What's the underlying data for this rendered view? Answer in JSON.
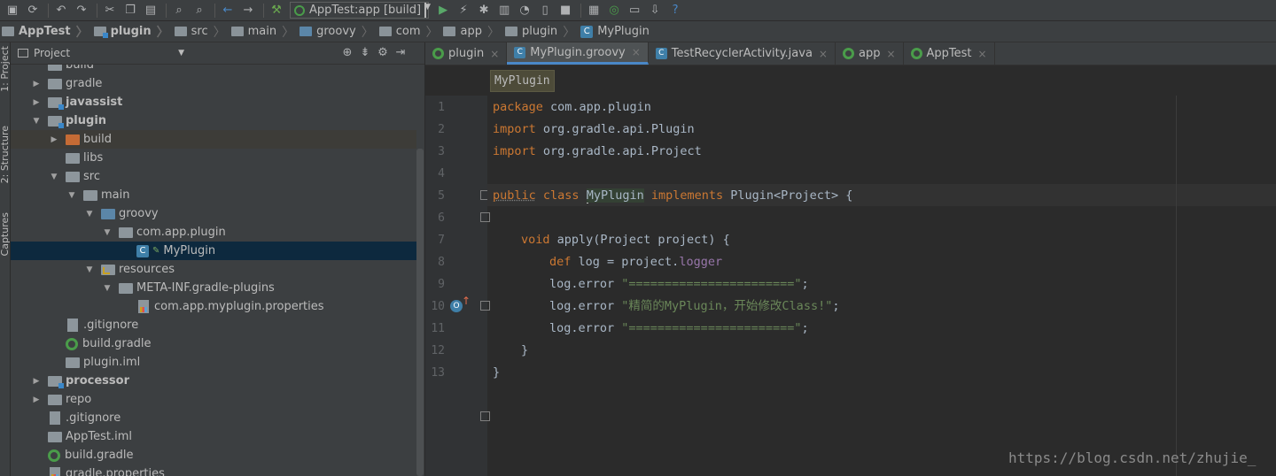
{
  "toolbar": {
    "icons": [
      "save-icon",
      "sync-icon",
      "undo-icon",
      "redo-icon",
      "cut-icon",
      "copy-icon",
      "paste-icon",
      "find-icon",
      "replace-icon",
      "back-icon",
      "forward-icon",
      "build-icon"
    ],
    "run_config": "AppTest:app [build]",
    "right_icons": [
      "run-icon",
      "debug-icon",
      "coverage-icon",
      "profile-icon",
      "attach-icon",
      "stop-icon",
      "sdk-icon",
      "avd-icon",
      "sync-gradle-icon",
      "structure-icon",
      "download-icon",
      "help-icon"
    ]
  },
  "breadcrumb": [
    "AppTest",
    "plugin",
    "src",
    "main",
    "groovy",
    "com",
    "app",
    "plugin",
    "MyPlugin"
  ],
  "side_tabs": {
    "project": "1: Project",
    "structure": "2: Structure",
    "captures": "Captures"
  },
  "project_panel": {
    "title": "Project",
    "tree": [
      {
        "label": "build",
        "level": 1,
        "arrow": "",
        "icon": "folder",
        "cut": true
      },
      {
        "label": "gradle",
        "level": 1,
        "arrow": "▶",
        "icon": "folder"
      },
      {
        "label": "javassist",
        "level": 1,
        "arrow": "▶",
        "icon": "module",
        "bold": true
      },
      {
        "label": "plugin",
        "level": 1,
        "arrow": "▼",
        "icon": "module",
        "bold": true
      },
      {
        "label": "build",
        "level": 2,
        "arrow": "▶",
        "icon": "orange"
      },
      {
        "label": "libs",
        "level": 2,
        "arrow": "",
        "icon": "folder"
      },
      {
        "label": "src",
        "level": 2,
        "arrow": "▼",
        "icon": "folder"
      },
      {
        "label": "main",
        "level": 3,
        "arrow": "▼",
        "icon": "folder"
      },
      {
        "label": "groovy",
        "level": 4,
        "arrow": "▼",
        "icon": "blue"
      },
      {
        "label": "com.app.plugin",
        "level": 5,
        "arrow": "▼",
        "icon": "package"
      },
      {
        "label": "MyPlugin",
        "level": 6,
        "arrow": "",
        "icon": "class"
      },
      {
        "label": "resources",
        "level": 4,
        "arrow": "▼",
        "icon": "res"
      },
      {
        "label": "META-INF.gradle-plugins",
        "level": 5,
        "arrow": "▼",
        "icon": "folder"
      },
      {
        "label": "com.app.myplugin.properties",
        "level": 6,
        "arrow": "",
        "icon": "properties"
      },
      {
        "label": ".gitignore",
        "level": 2,
        "arrow": "",
        "icon": "file"
      },
      {
        "label": "build.gradle",
        "level": 2,
        "arrow": "",
        "icon": "gradle"
      },
      {
        "label": "plugin.iml",
        "level": 2,
        "arrow": "",
        "icon": "iml"
      },
      {
        "label": "processor",
        "level": 1,
        "arrow": "▶",
        "icon": "module",
        "bold": true
      },
      {
        "label": "repo",
        "level": 1,
        "arrow": "▶",
        "icon": "folder"
      },
      {
        "label": ".gitignore",
        "level": 1,
        "arrow": "",
        "icon": "file"
      },
      {
        "label": "AppTest.iml",
        "level": 1,
        "arrow": "",
        "icon": "iml"
      },
      {
        "label": "build.gradle",
        "level": 1,
        "arrow": "",
        "icon": "gradle"
      },
      {
        "label": "gradle.properties",
        "level": 1,
        "arrow": "",
        "icon": "properties"
      }
    ]
  },
  "editor_tabs": [
    {
      "label": "plugin",
      "icon": "gradle",
      "active": false
    },
    {
      "label": "MyPlugin.groovy",
      "icon": "class",
      "active": true
    },
    {
      "label": "TestRecyclerActivity.java",
      "icon": "class",
      "active": false
    },
    {
      "label": "app",
      "icon": "gradle",
      "active": false
    },
    {
      "label": "AppTest",
      "icon": "gradle",
      "active": false
    }
  ],
  "editor": {
    "breadcrumb_chip": "MyPlugin",
    "line_numbers": [
      "1",
      "2",
      "3",
      "4",
      "5",
      "6",
      "7",
      "8",
      "9",
      "10",
      "11",
      "12",
      "13"
    ],
    "lines": {
      "l1_kw": "package",
      "l1_rest": " com.app.plugin",
      "l2_kw": "import",
      "l2_rest": " org.gradle.api.Plugin",
      "l3_kw": "import",
      "l3_rest": " org.gradle.api.Project",
      "l5_kw1": "public",
      "l5_kw2": " class ",
      "l5_name": "MyPlugin",
      "l5_kw3": " implements",
      "l5_rest": " Plugin<Project> {",
      "l7_kw": "void",
      "l7_rest": " apply(Project project) {",
      "l8_kw": "def",
      "l8_rest": " log = project.",
      "l8_field": "logger",
      "l9_call": "log.error ",
      "l9_str": "\"=======================\"",
      "l10_call": "log.error ",
      "l10_str": "\"精简的MyPlugin，开始修改Class!\"",
      "l11_call": "log.error ",
      "l11_str": "\"=======================\"",
      "l12": "}",
      "l13": "}"
    },
    "semicolon_mark": ";"
  },
  "watermark": "https://blog.csdn.net/zhujie_"
}
